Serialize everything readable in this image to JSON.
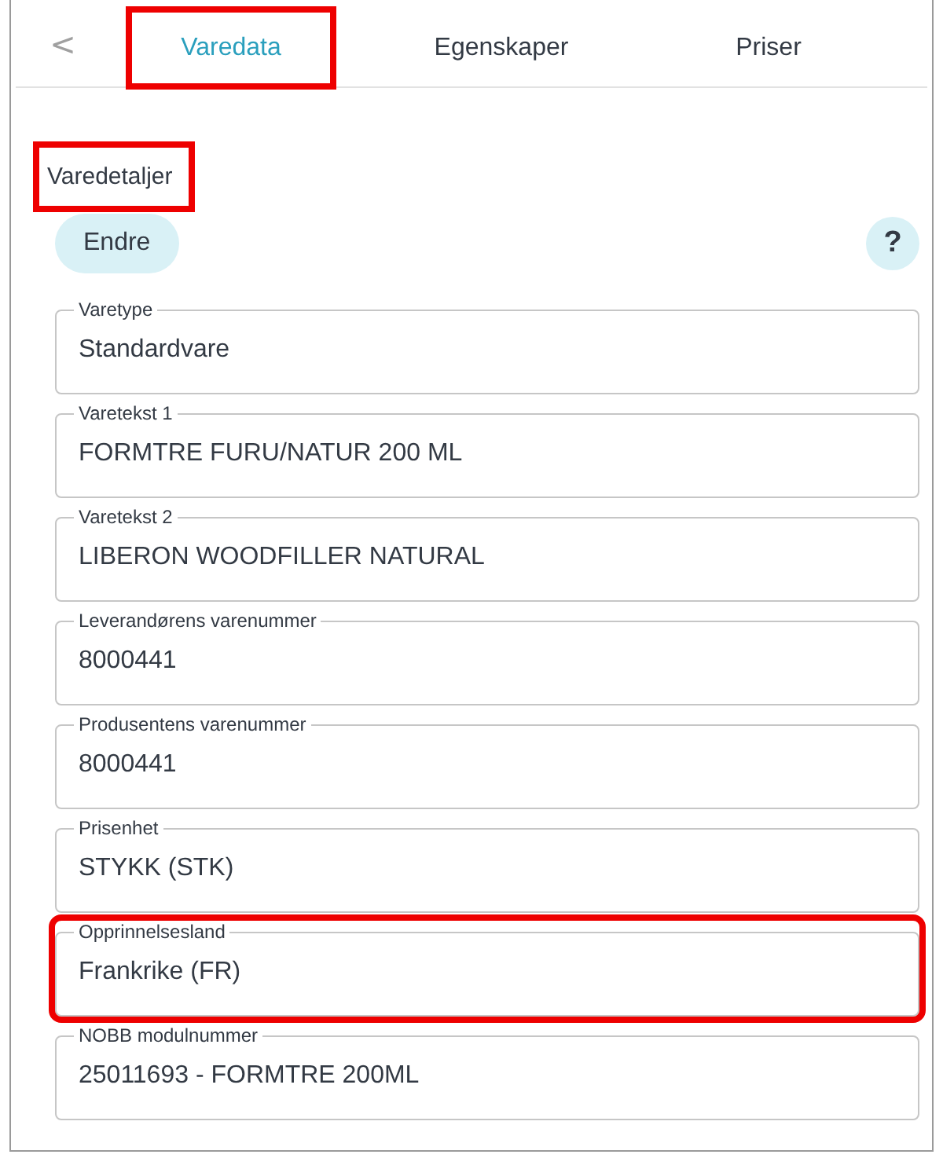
{
  "back_button": {
    "label": "<"
  },
  "tabs": [
    {
      "label": "Varedata",
      "selected": true,
      "highlighted": true
    },
    {
      "label": "Egenskaper",
      "selected": false,
      "highlighted": false
    },
    {
      "label": "Priser",
      "selected": false,
      "highlighted": false
    }
  ],
  "section": {
    "title": "Varedetaljer",
    "highlighted": true
  },
  "edit_button": {
    "label": "Endre"
  },
  "help_button": {
    "label": "?"
  },
  "fields": [
    {
      "label": "Varetype",
      "value": "Standardvare",
      "highlighted": false
    },
    {
      "label": "Varetekst 1",
      "value": "FORMTRE FURU/NATUR 200 ML",
      "highlighted": false
    },
    {
      "label": "Varetekst 2",
      "value": "LIBERON WOODFILLER NATURAL",
      "highlighted": false
    },
    {
      "label": "Leverandørens varenummer",
      "value": "8000441",
      "highlighted": false
    },
    {
      "label": "Produsentens varenummer",
      "value": "8000441",
      "highlighted": false
    },
    {
      "label": "Prisenhet",
      "value": "STYKK (STK)",
      "highlighted": false
    },
    {
      "label": "Opprinnelsesland",
      "value": "Frankrike (FR)",
      "highlighted": true
    },
    {
      "label": "NOBB modulnummer",
      "value": "25011693 - FORMTRE 200ML",
      "highlighted": false
    }
  ]
}
